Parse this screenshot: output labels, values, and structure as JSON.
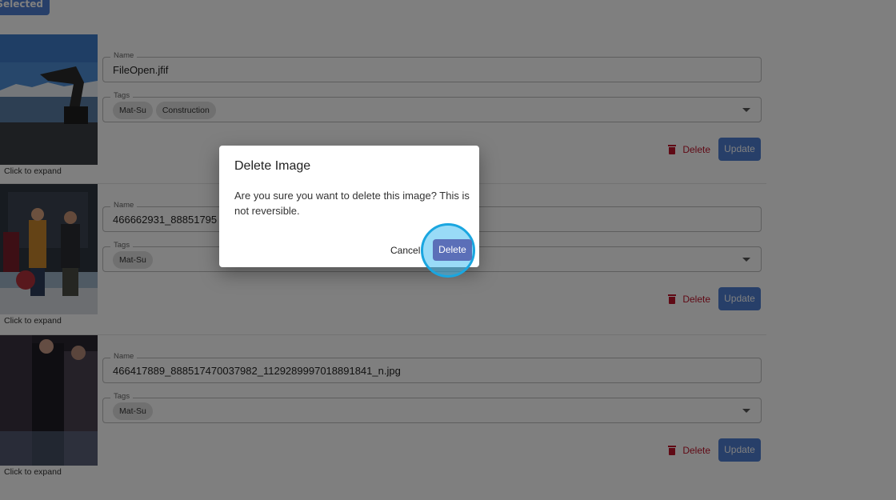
{
  "toolbar": {
    "top_button_label": "t Selected"
  },
  "cards": [
    {
      "expand_label": "Click to expand",
      "name_legend": "Name",
      "name_value": "FileOpen.jfif",
      "tags_legend": "Tags",
      "tags": [
        "Mat-Su",
        "Construction"
      ],
      "delete_label": "Delete",
      "update_label": "Update"
    },
    {
      "expand_label": "Click to expand",
      "name_legend": "Name",
      "name_value": "466662931_88851795",
      "tags_legend": "Tags",
      "tags": [
        "Mat-Su"
      ],
      "delete_label": "Delete",
      "update_label": "Update"
    },
    {
      "expand_label": "Click to expand",
      "name_legend": "Name",
      "name_value": "466417889_888517470037982_1129289997018891841_n.jpg",
      "tags_legend": "Tags",
      "tags": [
        "Mat-Su"
      ],
      "delete_label": "Delete",
      "update_label": "Update"
    }
  ],
  "dialog": {
    "title": "Delete Image",
    "message": "Are you sure you want to delete this image? This is not reversible.",
    "cancel_label": "Cancel",
    "confirm_label": "Delete"
  },
  "colors": {
    "primary": "#4f7ed2",
    "danger": "#c0142b",
    "backdrop": "rgba(0,0,0,0.5)",
    "click_highlight": "#1aa6e0"
  }
}
